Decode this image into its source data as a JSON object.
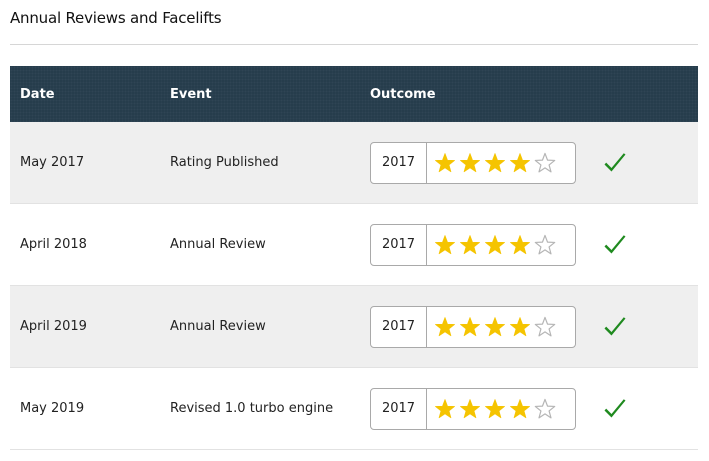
{
  "section": {
    "title": "Annual Reviews and Facelifts"
  },
  "table": {
    "headers": {
      "date": "Date",
      "event": "Event",
      "outcome": "Outcome"
    },
    "rows": [
      {
        "date": "May 2017",
        "event": "Rating Published",
        "year": "2017",
        "stars": 4,
        "max_stars": 5,
        "status": "check-icon"
      },
      {
        "date": "April 2018",
        "event": "Annual Review",
        "year": "2017",
        "stars": 4,
        "max_stars": 5,
        "status": "check-icon"
      },
      {
        "date": "April 2019",
        "event": "Annual Review",
        "year": "2017",
        "stars": 4,
        "max_stars": 5,
        "status": "check-icon"
      },
      {
        "date": "May 2019",
        "event": "Revised 1.0 turbo engine",
        "year": "2017",
        "stars": 4,
        "max_stars": 5,
        "status": "check-icon"
      }
    ]
  },
  "colors": {
    "header_bg": "#243b4b",
    "star_filled": "#f5c400",
    "star_empty": "#b5b5b5",
    "check": "#1f8a1f",
    "row_alt": "#efefef"
  }
}
